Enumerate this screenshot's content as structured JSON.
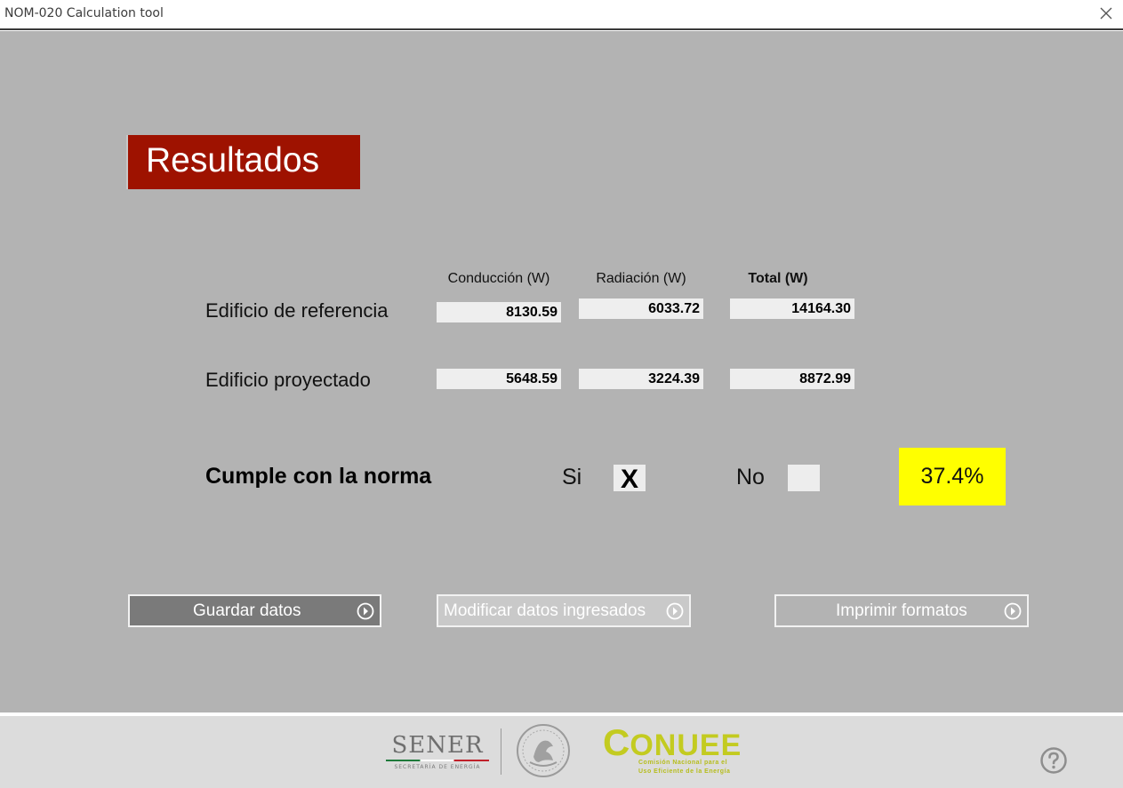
{
  "window": {
    "title": "NOM-020 Calculation tool",
    "close_icon": "close-icon"
  },
  "header": {
    "title": "Resultados",
    "color": "#9e1200"
  },
  "table": {
    "columns": [
      "Conducción (W)",
      "Radiación (W)",
      "Total (W)"
    ],
    "rows": [
      {
        "label": "Edificio de referencia",
        "values": [
          "8130.59",
          "6033.72",
          "14164.30"
        ]
      },
      {
        "label": "Edificio proyectado",
        "values": [
          "5648.59",
          "3224.39",
          "8872.99"
        ]
      }
    ]
  },
  "compliance": {
    "label": "Cumple con la norma",
    "yes_label": "Si",
    "yes_mark": "X",
    "no_label": "No",
    "no_mark": "",
    "percent": "37.4%",
    "percent_color": "#ffff00"
  },
  "buttons": {
    "save": "Guardar datos",
    "modify": "Modificar datos ingresados",
    "print": "Imprimir formatos",
    "arrow_icon": "arrow-right-circle-icon"
  },
  "footer": {
    "sener_word": "SENER",
    "sener_sub": "SECRETARÍA DE ENERGÍA",
    "conuee_c": "C",
    "conuee_rest": "ONUEE",
    "conuee_sub_1": "Comisión Nacional para el",
    "conuee_sub_2": "Uso Eficiente de la Energía",
    "help_icon": "help-icon"
  }
}
